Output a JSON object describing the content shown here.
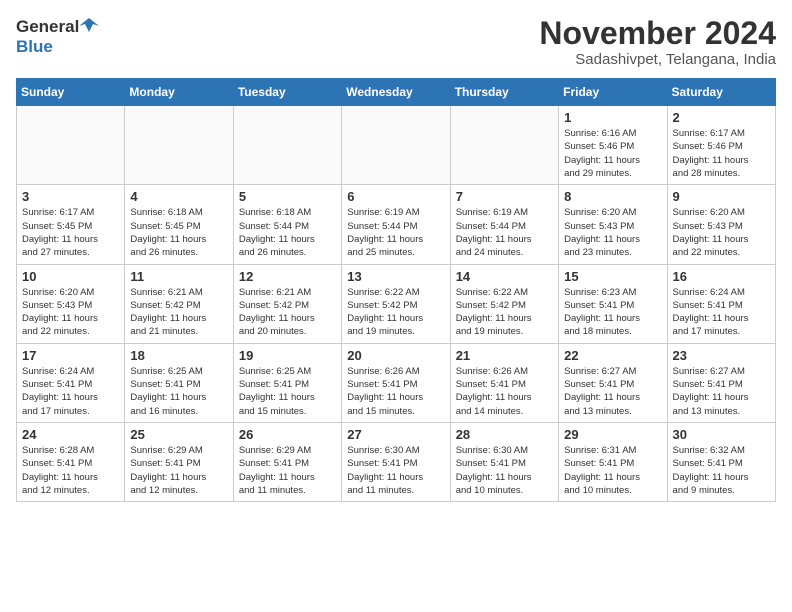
{
  "header": {
    "logo_line1": "General",
    "logo_line2": "Blue",
    "title": "November 2024",
    "subtitle": "Sadashivpet, Telangana, India"
  },
  "weekdays": [
    "Sunday",
    "Monday",
    "Tuesday",
    "Wednesday",
    "Thursday",
    "Friday",
    "Saturday"
  ],
  "weeks": [
    [
      {
        "day": "",
        "info": ""
      },
      {
        "day": "",
        "info": ""
      },
      {
        "day": "",
        "info": ""
      },
      {
        "day": "",
        "info": ""
      },
      {
        "day": "",
        "info": ""
      },
      {
        "day": "1",
        "info": "Sunrise: 6:16 AM\nSunset: 5:46 PM\nDaylight: 11 hours\nand 29 minutes."
      },
      {
        "day": "2",
        "info": "Sunrise: 6:17 AM\nSunset: 5:46 PM\nDaylight: 11 hours\nand 28 minutes."
      }
    ],
    [
      {
        "day": "3",
        "info": "Sunrise: 6:17 AM\nSunset: 5:45 PM\nDaylight: 11 hours\nand 27 minutes."
      },
      {
        "day": "4",
        "info": "Sunrise: 6:18 AM\nSunset: 5:45 PM\nDaylight: 11 hours\nand 26 minutes."
      },
      {
        "day": "5",
        "info": "Sunrise: 6:18 AM\nSunset: 5:44 PM\nDaylight: 11 hours\nand 26 minutes."
      },
      {
        "day": "6",
        "info": "Sunrise: 6:19 AM\nSunset: 5:44 PM\nDaylight: 11 hours\nand 25 minutes."
      },
      {
        "day": "7",
        "info": "Sunrise: 6:19 AM\nSunset: 5:44 PM\nDaylight: 11 hours\nand 24 minutes."
      },
      {
        "day": "8",
        "info": "Sunrise: 6:20 AM\nSunset: 5:43 PM\nDaylight: 11 hours\nand 23 minutes."
      },
      {
        "day": "9",
        "info": "Sunrise: 6:20 AM\nSunset: 5:43 PM\nDaylight: 11 hours\nand 22 minutes."
      }
    ],
    [
      {
        "day": "10",
        "info": "Sunrise: 6:20 AM\nSunset: 5:43 PM\nDaylight: 11 hours\nand 22 minutes."
      },
      {
        "day": "11",
        "info": "Sunrise: 6:21 AM\nSunset: 5:42 PM\nDaylight: 11 hours\nand 21 minutes."
      },
      {
        "day": "12",
        "info": "Sunrise: 6:21 AM\nSunset: 5:42 PM\nDaylight: 11 hours\nand 20 minutes."
      },
      {
        "day": "13",
        "info": "Sunrise: 6:22 AM\nSunset: 5:42 PM\nDaylight: 11 hours\nand 19 minutes."
      },
      {
        "day": "14",
        "info": "Sunrise: 6:22 AM\nSunset: 5:42 PM\nDaylight: 11 hours\nand 19 minutes."
      },
      {
        "day": "15",
        "info": "Sunrise: 6:23 AM\nSunset: 5:41 PM\nDaylight: 11 hours\nand 18 minutes."
      },
      {
        "day": "16",
        "info": "Sunrise: 6:24 AM\nSunset: 5:41 PM\nDaylight: 11 hours\nand 17 minutes."
      }
    ],
    [
      {
        "day": "17",
        "info": "Sunrise: 6:24 AM\nSunset: 5:41 PM\nDaylight: 11 hours\nand 17 minutes."
      },
      {
        "day": "18",
        "info": "Sunrise: 6:25 AM\nSunset: 5:41 PM\nDaylight: 11 hours\nand 16 minutes."
      },
      {
        "day": "19",
        "info": "Sunrise: 6:25 AM\nSunset: 5:41 PM\nDaylight: 11 hours\nand 15 minutes."
      },
      {
        "day": "20",
        "info": "Sunrise: 6:26 AM\nSunset: 5:41 PM\nDaylight: 11 hours\nand 15 minutes."
      },
      {
        "day": "21",
        "info": "Sunrise: 6:26 AM\nSunset: 5:41 PM\nDaylight: 11 hours\nand 14 minutes."
      },
      {
        "day": "22",
        "info": "Sunrise: 6:27 AM\nSunset: 5:41 PM\nDaylight: 11 hours\nand 13 minutes."
      },
      {
        "day": "23",
        "info": "Sunrise: 6:27 AM\nSunset: 5:41 PM\nDaylight: 11 hours\nand 13 minutes."
      }
    ],
    [
      {
        "day": "24",
        "info": "Sunrise: 6:28 AM\nSunset: 5:41 PM\nDaylight: 11 hours\nand 12 minutes."
      },
      {
        "day": "25",
        "info": "Sunrise: 6:29 AM\nSunset: 5:41 PM\nDaylight: 11 hours\nand 12 minutes."
      },
      {
        "day": "26",
        "info": "Sunrise: 6:29 AM\nSunset: 5:41 PM\nDaylight: 11 hours\nand 11 minutes."
      },
      {
        "day": "27",
        "info": "Sunrise: 6:30 AM\nSunset: 5:41 PM\nDaylight: 11 hours\nand 11 minutes."
      },
      {
        "day": "28",
        "info": "Sunrise: 6:30 AM\nSunset: 5:41 PM\nDaylight: 11 hours\nand 10 minutes."
      },
      {
        "day": "29",
        "info": "Sunrise: 6:31 AM\nSunset: 5:41 PM\nDaylight: 11 hours\nand 10 minutes."
      },
      {
        "day": "30",
        "info": "Sunrise: 6:32 AM\nSunset: 5:41 PM\nDaylight: 11 hours\nand 9 minutes."
      }
    ]
  ]
}
